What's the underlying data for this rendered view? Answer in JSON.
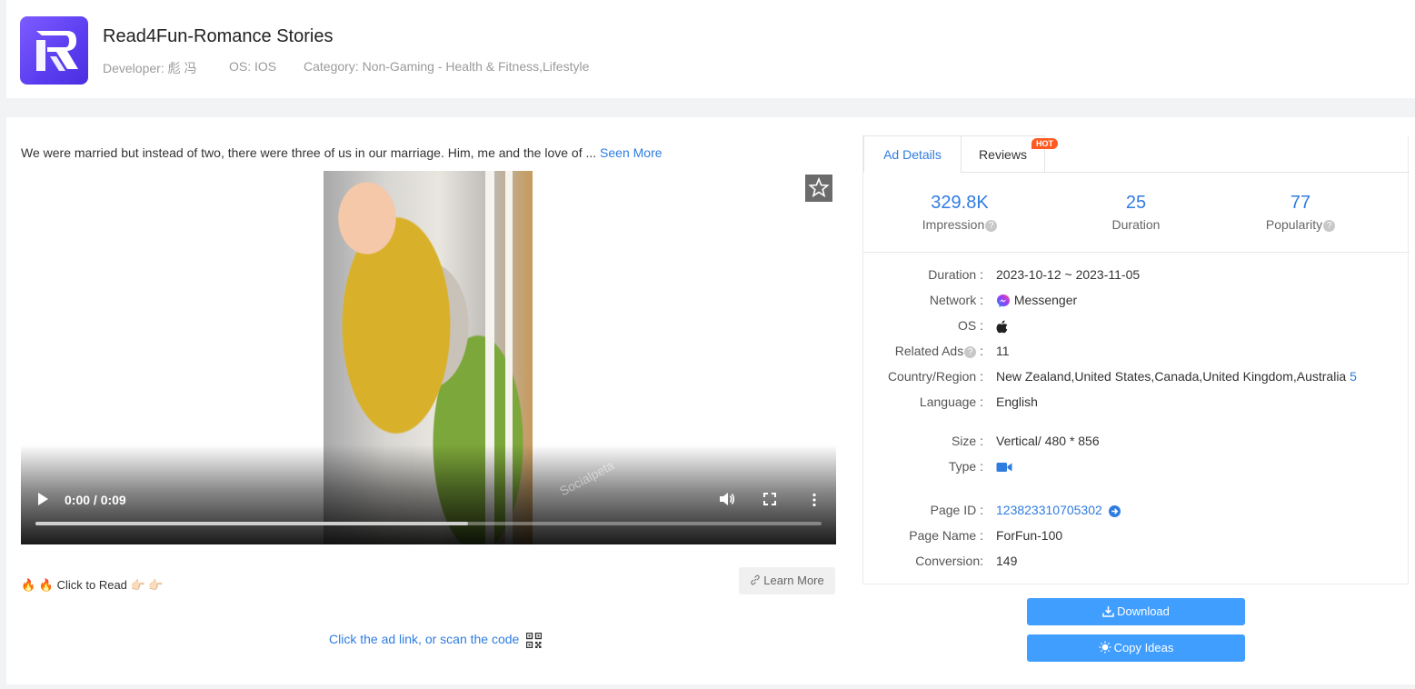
{
  "app": {
    "title": "Read4Fun-Romance Stories",
    "developer": "Developer: 彪 冯",
    "os": "OS: IOS",
    "category": "Category: Non-Gaming - Health & Fitness,Lifestyle",
    "logo_icon": "read4fun-logo-icon"
  },
  "ad": {
    "text": "We were married but instead of two, there were three of us in our marriage. Him, me and the love of ...",
    "seen_more": "Seen More",
    "cta_text": "🔥 🔥 Click to Read 👉🏻 👉🏻",
    "learn_more": "Learn More",
    "scan_text": "Click the ad link, or scan the code",
    "watermark": "Socialpeta"
  },
  "video": {
    "time": "0:00 / 0:09",
    "progress": 0.55
  },
  "tabs": [
    "Ad Details",
    "Reviews"
  ],
  "hot_badge": "HOT",
  "stats": [
    {
      "value": "329.8K",
      "label": "Impression",
      "help": true
    },
    {
      "value": "25",
      "label": "Duration",
      "help": false
    },
    {
      "value": "77",
      "label": "Popularity",
      "help": true
    }
  ],
  "details": {
    "duration_label": "Duration :",
    "duration": "2023-10-12 ~ 2023-11-05",
    "network_label": "Network :",
    "network": "Messenger",
    "os_label": "OS :",
    "os_icon": "apple-icon",
    "related_label": "Related Ads",
    "related_colon": ":",
    "related": "11",
    "country_label": "Country/Region :",
    "country": "New Zealand,United States,Canada,United Kingdom,Australia",
    "country_count": "5",
    "language_label": "Language :",
    "language": "English",
    "size_label": "Size :",
    "size": "Vertical/ 480 * 856",
    "type_label": "Type :",
    "type_icon": "video-camera-icon",
    "page_id_label": "Page ID :",
    "page_id": "123823310705302",
    "page_name_label": "Page Name :",
    "page_name": "ForFun-100",
    "conversion_label": "Conversion:",
    "conversion": "149"
  },
  "buttons": {
    "download": "Download",
    "copy_ideas": "Copy Ideas"
  },
  "colors": {
    "accent": "#2f7ce0",
    "button": "#409eff",
    "hot": "#ff5a1f"
  }
}
